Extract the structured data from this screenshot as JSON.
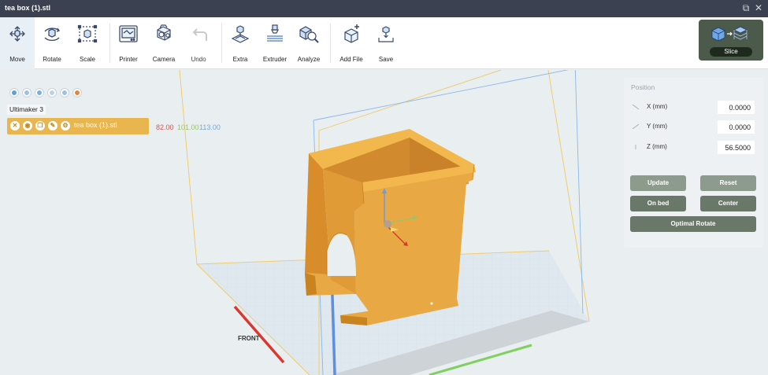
{
  "window": {
    "title": "tea box (1).stl",
    "restore_glyph": "⧉",
    "close_glyph": "✕"
  },
  "toolbar": {
    "items": [
      {
        "label": "Move",
        "icon": "move-icon"
      },
      {
        "label": "Rotate",
        "icon": "rotate-icon"
      },
      {
        "label": "Scale",
        "icon": "scale-icon"
      },
      {
        "label": "Printer",
        "icon": "printer-icon"
      },
      {
        "label": "Camera",
        "icon": "camera-icon"
      },
      {
        "label": "Undo",
        "icon": "undo-icon"
      },
      {
        "label": "Extra",
        "icon": "extra-icon"
      },
      {
        "label": "Extruder",
        "icon": "extruder-icon"
      },
      {
        "label": "Analyze",
        "icon": "analyze-icon"
      },
      {
        "label": "Add File",
        "icon": "add-file-icon"
      },
      {
        "label": "Save",
        "icon": "save-icon"
      }
    ],
    "slice_label": "Slice"
  },
  "object_panel": {
    "printer_name": "Ultimaker 3",
    "object_name": "tea box (1).stl",
    "dims": {
      "x": "82.00",
      "y": "101.00",
      "z": "113.00"
    },
    "colors": {
      "x": "#d9534f",
      "y": "#8fc86a",
      "z": "#7aa7d9",
      "row": "#e8b54e"
    }
  },
  "position_panel": {
    "title": "Position",
    "x_label": "X (mm)",
    "x_value": "0.0000",
    "y_label": "Y (mm)",
    "y_value": "0.0000",
    "z_label": "Z (mm)",
    "z_value": "56.5000",
    "update_label": "Update",
    "reset_label": "Reset",
    "on_bed_label": "On bed",
    "center_label": "Center",
    "optimal_rotate_label": "Optimal Rotate"
  },
  "viewport": {
    "front_label": "FRONT",
    "model_color": "#e8a944",
    "build_volume_color": "#f0c860"
  }
}
